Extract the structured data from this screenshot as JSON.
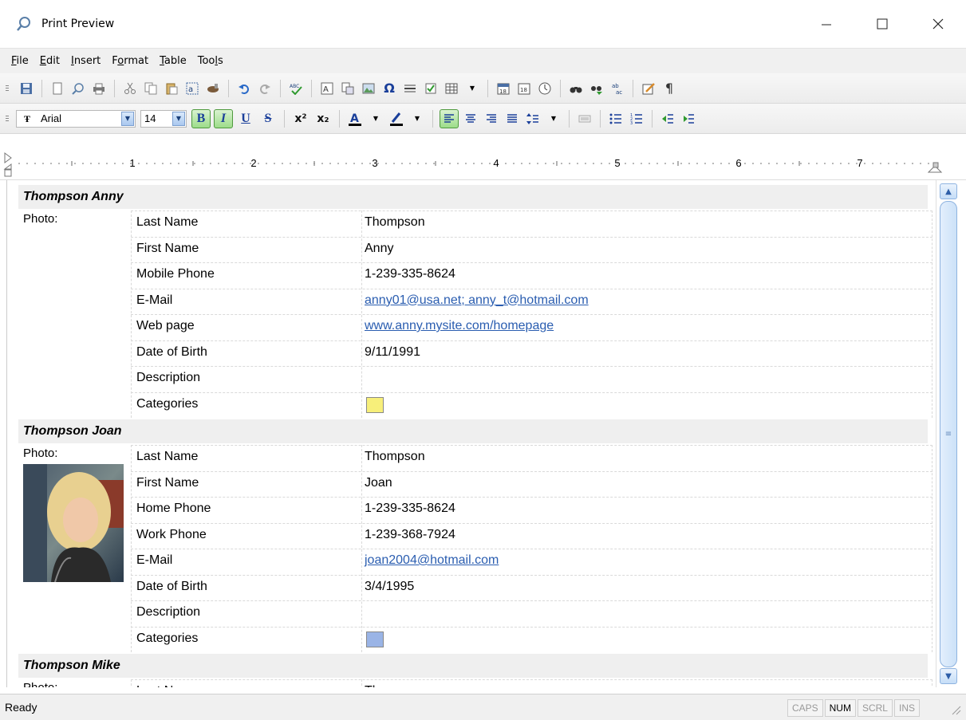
{
  "window": {
    "title": "Print Preview"
  },
  "menu": [
    {
      "label": "File",
      "u": "F",
      "rest": "ile"
    },
    {
      "label": "Edit",
      "u": "E",
      "rest": "dit"
    },
    {
      "label": "Insert",
      "u": "I",
      "rest": "nsert"
    },
    {
      "label": "Format",
      "pre": "F",
      "u": "o",
      "rest": "rmat"
    },
    {
      "label": "Table",
      "u": "T",
      "rest": "able"
    },
    {
      "label": "Tools",
      "pre": "Too",
      "u": "l",
      "rest": "s"
    }
  ],
  "format_toolbar": {
    "font_name": "Arial",
    "font_size": "14"
  },
  "ruler": {
    "numbers": [
      "1",
      "2",
      "3",
      "4",
      "5",
      "6",
      "7"
    ]
  },
  "records": [
    {
      "header": "Thompson Anny",
      "photo_label": "Photo:",
      "fields": [
        {
          "label": "Last Name",
          "value": "Thompson"
        },
        {
          "label": "First Name",
          "value": "Anny"
        },
        {
          "label": "Mobile Phone",
          "value": "1-239-335-8624"
        },
        {
          "label": "E-Mail",
          "value": "anny01@usa.net; anny_t@hotmail.com",
          "link": true
        },
        {
          "label": "Web page",
          "value": "www.anny.mysite.com/homepage",
          "link": true
        },
        {
          "label": "Date of Birth",
          "value": "9/11/1991"
        },
        {
          "label": "Description",
          "value": ""
        },
        {
          "label": "Categories",
          "value": ""
        }
      ],
      "category_color": "#f7ef7a"
    },
    {
      "header": "Thompson Joan",
      "photo_label": "Photo:",
      "fields": [
        {
          "label": "Last Name",
          "value": "Thompson"
        },
        {
          "label": "First Name",
          "value": "Joan"
        },
        {
          "label": "Home Phone",
          "value": "1-239-335-8624"
        },
        {
          "label": "Work Phone",
          "value": "1-239-368-7924"
        },
        {
          "label": "E-Mail",
          "value": "joan2004@hotmail.com",
          "link": true
        },
        {
          "label": "Date of Birth",
          "value": "3/4/1995"
        },
        {
          "label": "Description",
          "value": ""
        },
        {
          "label": "Categories",
          "value": ""
        }
      ],
      "category_color": "#9ab4e6"
    },
    {
      "header": "Thompson Mike",
      "photo_label": "Photo:",
      "fields": [
        {
          "label": "Last Name",
          "value": "Th"
        }
      ]
    }
  ],
  "status": {
    "text": "Ready",
    "indicators": [
      {
        "label": "CAPS",
        "on": false
      },
      {
        "label": "NUM",
        "on": true
      },
      {
        "label": "SCRL",
        "on": false
      },
      {
        "label": "INS",
        "on": false
      }
    ]
  }
}
